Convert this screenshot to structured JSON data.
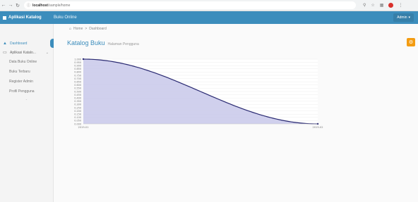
{
  "browser": {
    "back_icon": "arrow-left-icon",
    "forward_icon": "arrow-right-icon",
    "reload_icon": "reload-icon",
    "url_host": "localhost",
    "url_path": "/sample/home"
  },
  "header": {
    "brand": "Aplikasi Katalog",
    "title": "Buku Online",
    "user": "Admin"
  },
  "sidebar": {
    "dashboard": "Dashboard",
    "menu": "Aplikasi Katalo...",
    "items": [
      "Data Buku Online",
      "Buku Terbaru",
      "Register Admin",
      "Profil Pengguna"
    ],
    "small": "-"
  },
  "breadcrumb": {
    "home": "Home",
    "current": "Dashboard"
  },
  "page": {
    "title": "Katalog Buku",
    "subtitle": "Halaman Pengguna"
  },
  "colors": {
    "header": "#3c8dbc",
    "area_fill": "#c8c8ea",
    "line": "#2a2a72",
    "accent": "#f39c12"
  },
  "chart_data": {
    "type": "area",
    "x": [
      "2019-01",
      "2019-02"
    ],
    "xlim": [
      "2019-01",
      "2019-02"
    ],
    "ylim": [
      0,
      1
    ],
    "y_ticks": [
      "0.000",
      "0.050",
      "0.100",
      "0.150",
      "0.200",
      "0.250",
      "0.300",
      "0.350",
      "0.400",
      "0.450",
      "0.500",
      "0.550",
      "0.600",
      "0.650",
      "0.700",
      "0.750",
      "0.800",
      "0.850",
      "0.900",
      "0.950",
      "1.000"
    ],
    "series": [
      {
        "values": [
          1.0,
          0.0
        ]
      }
    ],
    "curve": "smooth-s"
  }
}
